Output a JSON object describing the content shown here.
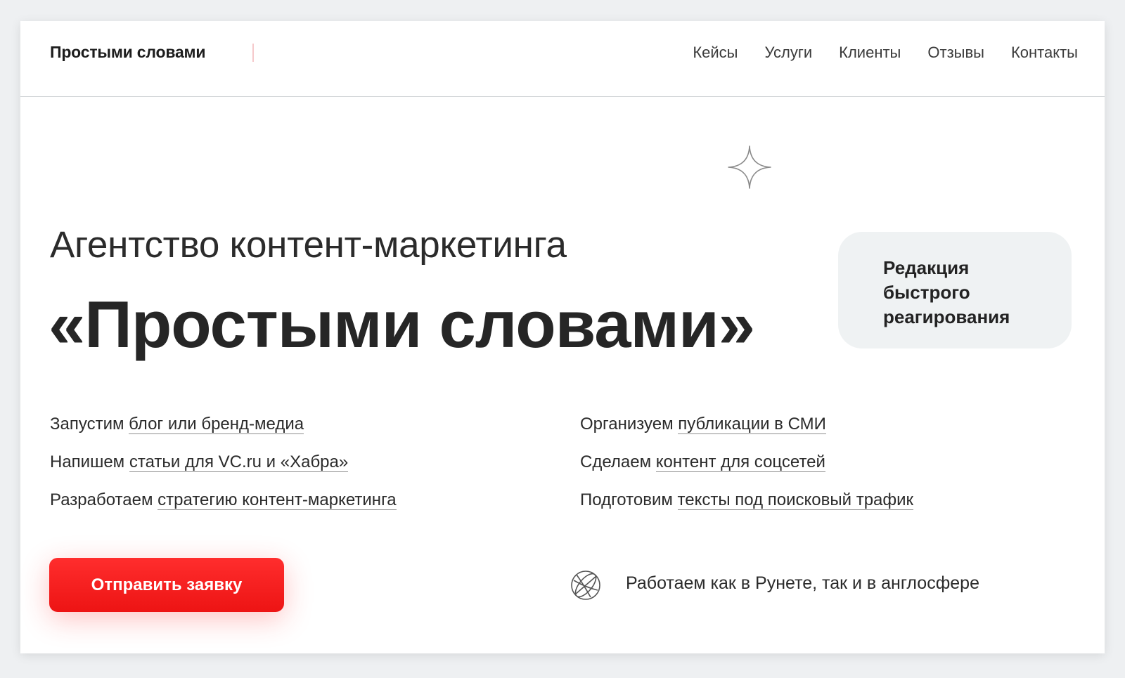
{
  "header": {
    "logo": "Простыми словами",
    "nav": [
      "Кейсы",
      "Услуги",
      "Клиенты",
      "Отзывы",
      "Контакты"
    ]
  },
  "hero": {
    "kicker": "Агентство контент-маркетинга",
    "title": "«Простыми словами»",
    "badge": "Редакция быстрого реагирования"
  },
  "services": {
    "left": [
      {
        "verb": "Запустим",
        "link": "блог или бренд-медиа"
      },
      {
        "verb": "Напишем",
        "link": "статьи для VC.ru и «Хабра»"
      },
      {
        "verb": "Разработаем",
        "link": "стратегию контент-маркетинга"
      }
    ],
    "right": [
      {
        "verb": "Организуем",
        "link": "публикации в СМИ"
      },
      {
        "verb": "Сделаем",
        "link": "контент для соцсетей"
      },
      {
        "verb": "Подготовим",
        "link": "тексты под поисковый трафик"
      }
    ]
  },
  "footer": {
    "cta": "Отправить заявку",
    "geo_text": "Работаем как в Рунете, так и в англосфере",
    "geo_icon": "globe-icon"
  },
  "colors": {
    "accent": "#ff2020",
    "text": "#222222",
    "badge_bg": "#eff2f3",
    "page_bg": "#ffffff"
  }
}
